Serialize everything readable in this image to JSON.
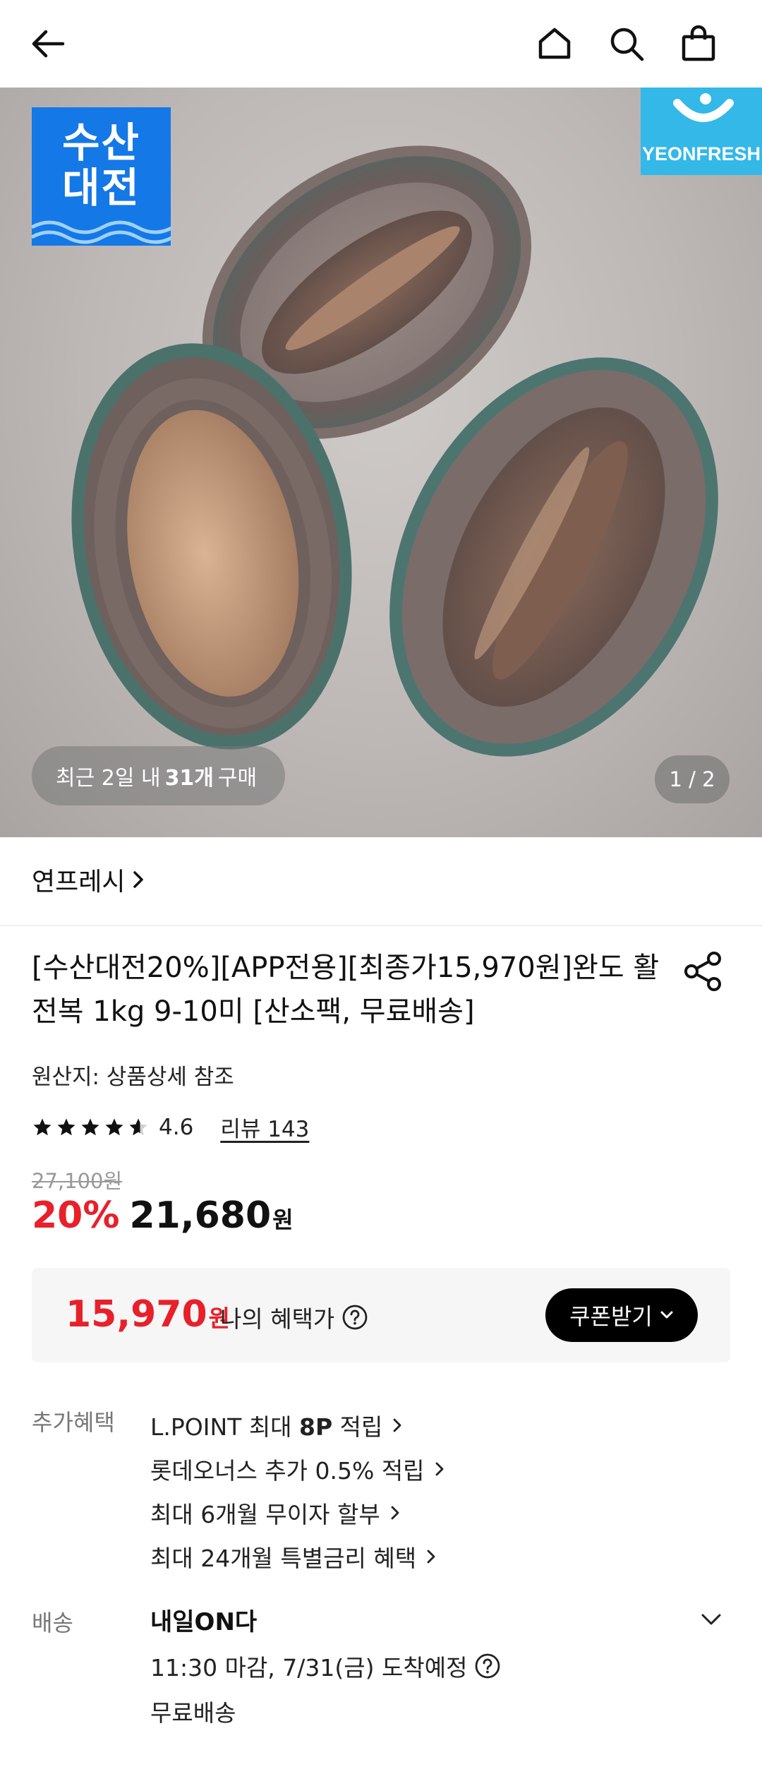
{
  "header": {
    "icons": [
      "back-arrow-icon",
      "home-icon",
      "search-icon",
      "shopping-bag-icon"
    ]
  },
  "hero": {
    "sale_badge_line1": "수산",
    "sale_badge_line2": "대전",
    "brand_logo_text": "YEONFRESH",
    "recent_prefix": "최근 2일 내",
    "recent_count": "31개",
    "recent_suffix": "구매",
    "page_indicator": "1 / 2"
  },
  "seller": {
    "name": "연프레시"
  },
  "product": {
    "title": "[수산대전20%][APP전용][최종가15,970원]완도 활전복 1kg 9-10미 [산소팩, 무료배송]",
    "origin": "원산지: 상품상세 참조",
    "rating_value": "4.6",
    "rating_stars": 4.6,
    "review_link": "리뷰 143",
    "original_price": "27,100원",
    "discount": "20%",
    "price": "21,680",
    "price_unit": "원"
  },
  "benefit": {
    "price": "15,970",
    "price_unit": "원",
    "label": "나의 혜택가",
    "coupon_button": "쿠폰받기"
  },
  "extra_benefits": {
    "label": "추가혜택",
    "items": [
      {
        "pre": "L.POINT 최대 ",
        "bold": "8P",
        "post": " 적립"
      },
      {
        "pre": "롯데오너스 추가 0.5% 적립",
        "bold": "",
        "post": ""
      },
      {
        "pre": "최대 6개월 무이자 할부",
        "bold": "",
        "post": ""
      },
      {
        "pre": "최대 24개월 특별금리 혜택",
        "bold": "",
        "post": ""
      }
    ]
  },
  "delivery": {
    "label": "배송",
    "title": "내일ON다",
    "time": "11:30 마감, 7/31(금) 도착예정",
    "fee": "무료배송"
  },
  "colors": {
    "discount_red": "#e8202a",
    "sale_badge_blue": "#1478e6",
    "brand_logo_blue": "#33b8e8"
  }
}
